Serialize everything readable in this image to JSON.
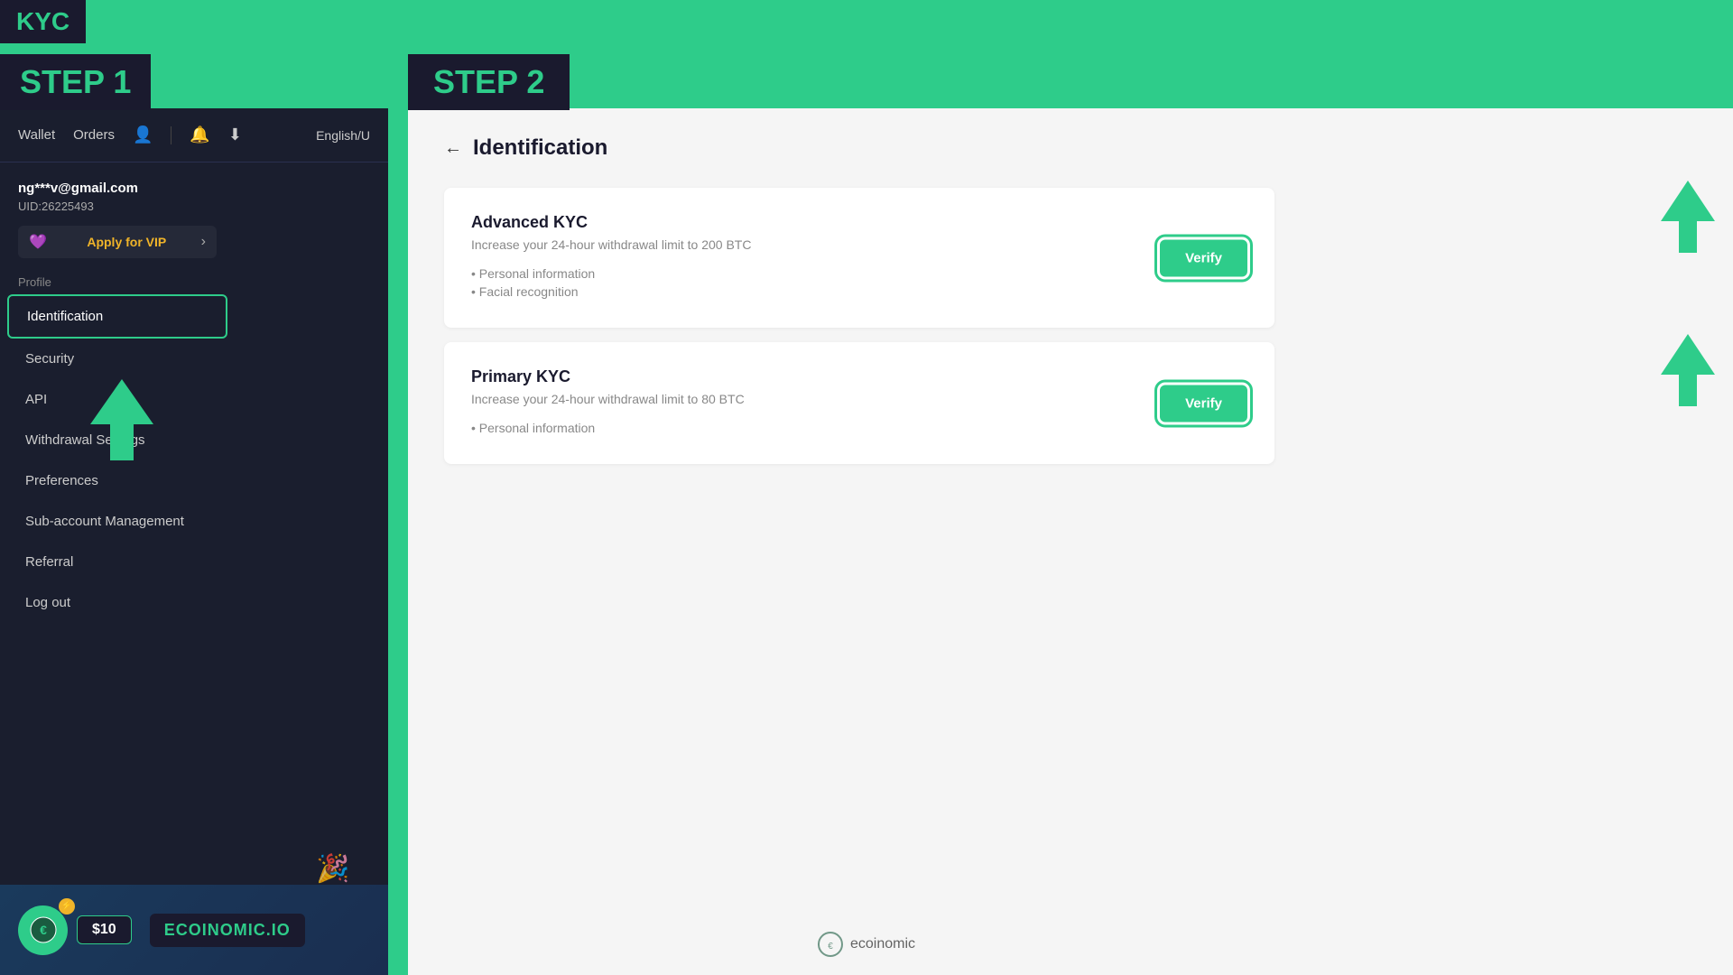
{
  "kyc_badge": "KYC",
  "step1_badge": "STEP 1",
  "step2_badge": "STEP 2",
  "nav": {
    "wallet": "Wallet",
    "orders": "Orders",
    "language": "English/U"
  },
  "user": {
    "email": "ng***v@gmail.com",
    "uid": "UID:26225493",
    "vip_label": "Apply for VIP"
  },
  "sidebar": {
    "profile_label": "Profile",
    "items": [
      {
        "label": "Identification",
        "active": true
      },
      {
        "label": "Security",
        "active": false
      },
      {
        "label": "API",
        "active": false
      },
      {
        "label": "Withdrawal Settings",
        "active": false
      },
      {
        "label": "Preferences",
        "active": false
      },
      {
        "label": "Sub-account Management",
        "active": false
      },
      {
        "label": "Referral",
        "active": false
      },
      {
        "label": "Log out",
        "active": false
      }
    ]
  },
  "identification_page": {
    "back_label": "←",
    "title": "Identification",
    "advanced_kyc": {
      "title": "Advanced KYC",
      "subtitle": "Increase your 24-hour withdrawal limit to 200 BTC",
      "features": [
        "Personal information",
        "Facial recognition"
      ],
      "verify_label": "Verify"
    },
    "primary_kyc": {
      "title": "Primary KYC",
      "subtitle": "Increase your 24-hour withdrawal limit to 80 BTC",
      "features": [
        "Personal information"
      ],
      "verify_label": "Verify"
    }
  },
  "bottom": {
    "coin_badge": "⚡",
    "amount": "$10",
    "brand": "ECOINOMIC.IO"
  },
  "watermark": "ecoinomic"
}
